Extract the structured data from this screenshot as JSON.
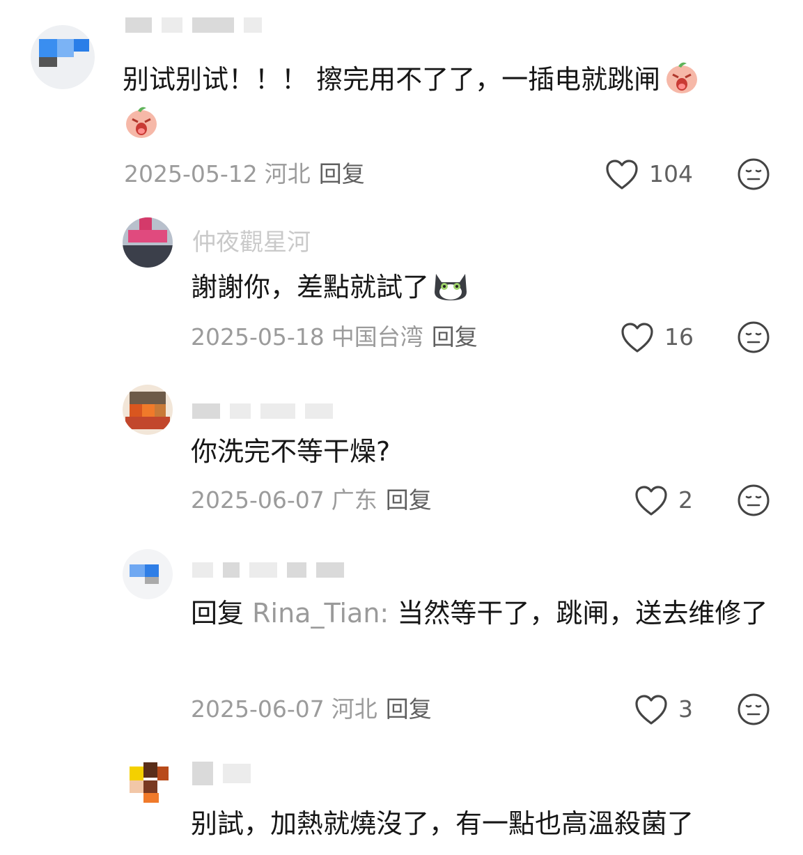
{
  "comments": [
    {
      "username": "",
      "text": "别试别试！！！ 擦完用不了了，一插电就跳闸",
      "reply_prefix": "",
      "reply_target": "",
      "date": "2025-05-12",
      "region": "河北",
      "reply_label": "回复",
      "likes": "104",
      "emoji": "crying-peach-emoji"
    },
    {
      "username": "仲夜觀星河",
      "text": "謝謝你，差點就試了",
      "reply_prefix": "",
      "reply_target": "",
      "date": "2025-05-18",
      "region": "中国台湾",
      "reply_label": "回复",
      "likes": "16",
      "emoji": "cat-emoji"
    },
    {
      "username": "",
      "text": "你洗完不等干燥?",
      "reply_prefix": "",
      "reply_target": "",
      "date": "2025-06-07",
      "region": "广东",
      "reply_label": "回复",
      "likes": "2",
      "emoji": ""
    },
    {
      "username": "",
      "text": "当然等干了，跳闸，送去维修了",
      "reply_prefix": "回复",
      "reply_target": "Rina_Tian:",
      "date": "2025-06-07",
      "region": "河北",
      "reply_label": "回复",
      "likes": "3",
      "emoji": ""
    },
    {
      "username": "",
      "text": "别試，加熱就燒沒了，有一點也高溫殺菌了",
      "reply_prefix": "",
      "reply_target": "",
      "date": "",
      "region": "",
      "reply_label": "",
      "likes": "",
      "emoji": ""
    }
  ],
  "colors": {
    "text": "#161616",
    "meta": "#9b9b9b",
    "reply_button": "#5f5f5f",
    "icon": "#444444",
    "reply_target": "#9a9a9a"
  },
  "icons": {
    "like": "heart-outline-icon",
    "dislike": "neutral-face-icon"
  }
}
